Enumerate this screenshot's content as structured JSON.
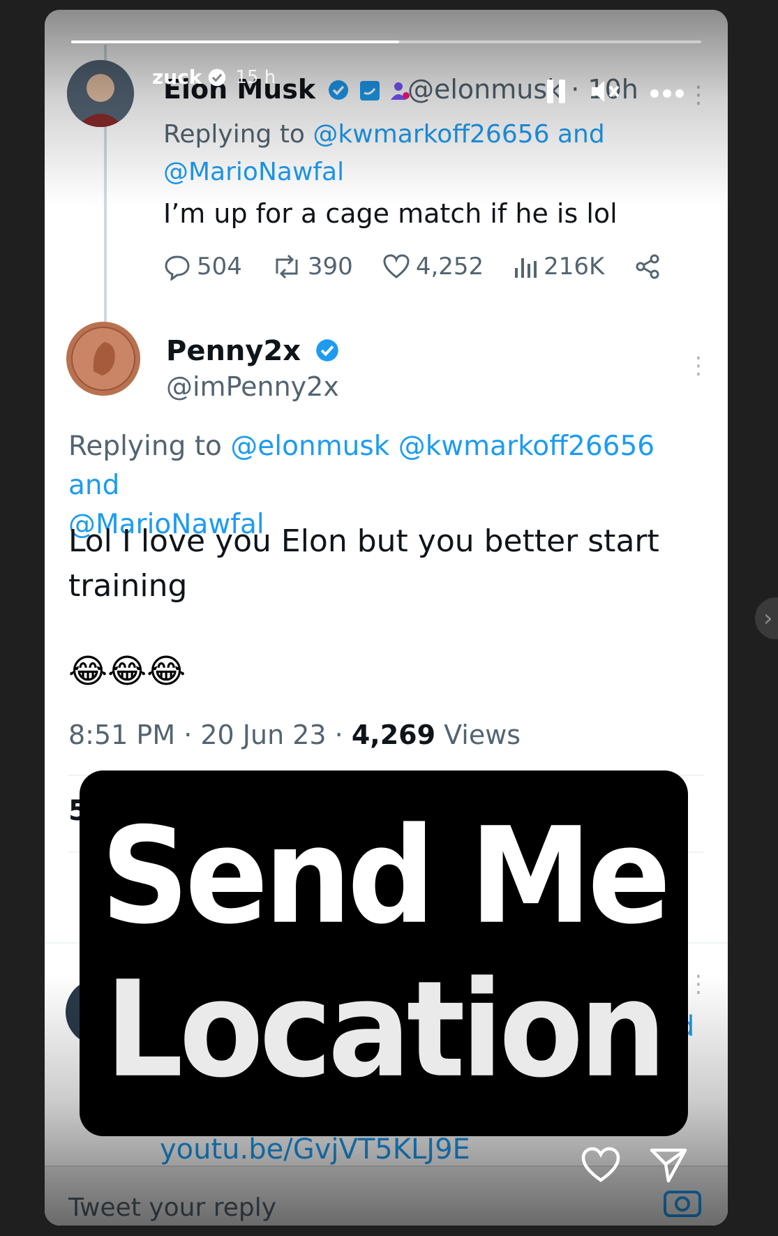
{
  "story": {
    "username": "zuck",
    "time_ago": "15 h",
    "progress": 0.52
  },
  "tweet1": {
    "name": "Elon Musk",
    "handle_time": "@elonmusk · 10h",
    "replying_prefix": "Replying to ",
    "replying_to_1": "@kwmarkoff26656",
    "replying_and": " and",
    "replying_to_2": "@MarioNawfal",
    "text": "I’m up for a cage match if he is lol",
    "replies": "504",
    "retweets": "390",
    "likes": "4,252",
    "views": "216K"
  },
  "tweet2": {
    "name": "Penny2x",
    "handle": "@imPenny2x",
    "replying_prefix": "Replying to ",
    "replying_to_1": "@elonmusk @kwmarkoff26656",
    "replying_and": " and",
    "replying_to_2": "@MarioNawfal",
    "text": "Lol I love you Elon but you better start training",
    "emojis": "😂😂😂",
    "time_date": "8:51 PM · 20 Jun 23 · ",
    "views_count": "4,269",
    "views_label": " Views"
  },
  "partial": {
    "stat_fragment": "5",
    "link_fragment_end": "d",
    "link_fragment": "youtu.be/GvjVT5KLJ9E",
    "reply_placeholder": "Tweet your reply"
  },
  "caption": {
    "line1": "Send Me",
    "line2": "Location"
  },
  "colors": {
    "link": "#1d9bf0",
    "verified": "#1d9bf0",
    "caption_bg": "#000000"
  }
}
